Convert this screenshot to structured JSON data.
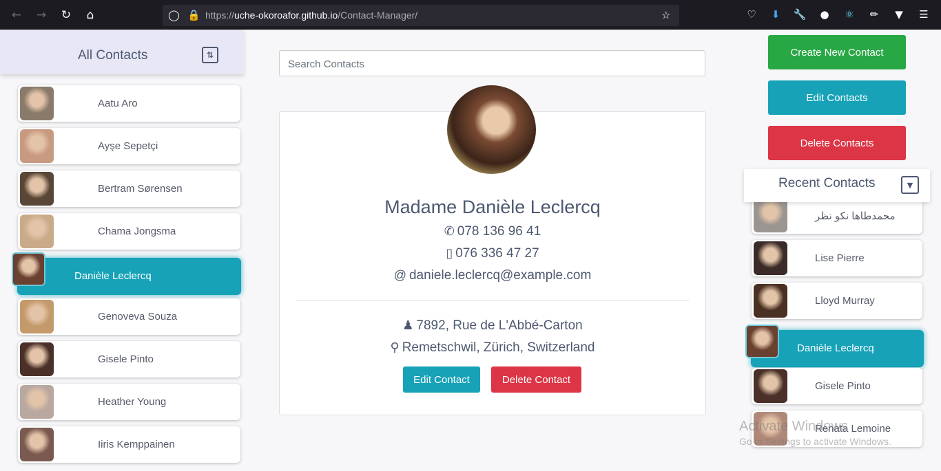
{
  "browser": {
    "url_prefix": "https://",
    "url_host": "uche-okoroafor.github.io",
    "url_path": "/Contact-Manager/"
  },
  "left_panel": {
    "title": "All Contacts",
    "contacts": [
      {
        "name": "Aatu Aro",
        "color": "#8a7a6a"
      },
      {
        "name": "Ayşe Sepetçi",
        "color": "#c99a82"
      },
      {
        "name": "Bertram Sørensen",
        "color": "#5a4636"
      },
      {
        "name": "Chama Jongsma",
        "color": "#c9ab8a"
      },
      {
        "name": "Danièle Leclercq",
        "color": "#6a4030",
        "active": true
      },
      {
        "name": "Genoveva Souza",
        "color": "#c49a6a"
      },
      {
        "name": "Gisele Pinto",
        "color": "#4a3028"
      },
      {
        "name": "Heather Young",
        "color": "#b8a8a0"
      },
      {
        "name": "Iiris Kemppainen",
        "color": "#7a5a50"
      }
    ]
  },
  "search": {
    "placeholder": "Search Contacts"
  },
  "detail": {
    "name": "Madame Danièle Leclercq",
    "phone": "078 136 96 41",
    "mobile": "076 336 47 27",
    "email": "daniele.leclercq@example.com",
    "street": "7892, Rue de L'Abbé-Carton",
    "city": "Remetschwil, Zürich, Switzerland",
    "edit_label": "Edit Contact",
    "delete_label": "Delete Contact"
  },
  "right_panel": {
    "create_label": "Create New Contact",
    "edit_label": "Edit Contacts",
    "delete_label": "Delete Contacts",
    "recent_title": "Recent Contacts",
    "recent": [
      {
        "name": "محمدطاها نکو نظر",
        "color": "#9a9590"
      },
      {
        "name": "Lise Pierre",
        "color": "#3a2a28"
      },
      {
        "name": "Lloyd Murray",
        "color": "#4a3022"
      },
      {
        "name": "Danièle Leclercq",
        "color": "#6a4030",
        "active": true
      },
      {
        "name": "Gisele Pinto",
        "color": "#4a3028"
      },
      {
        "name": "Renata Lemoine",
        "color": "#b08878"
      }
    ]
  },
  "watermark": {
    "title": "Activate Windows",
    "subtitle": "Go to Settings to activate Windows."
  },
  "colors": {
    "green": "#28a745",
    "teal": "#17a2b8",
    "red": "#dc3545"
  }
}
